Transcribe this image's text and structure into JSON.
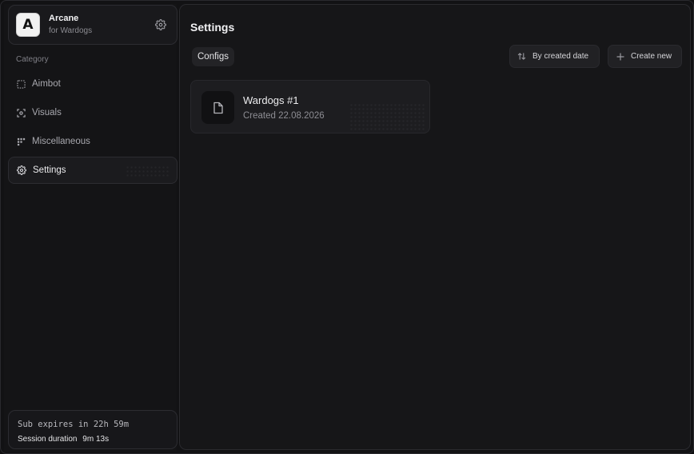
{
  "app": {
    "name": "Arcane",
    "subtitle": "for Wardogs",
    "logo_letter": "A"
  },
  "sidebar": {
    "category_label": "Category",
    "items": [
      {
        "label": "Aimbot",
        "icon": "aimbot-icon",
        "active": false
      },
      {
        "label": "Visuals",
        "icon": "visuals-icon",
        "active": false
      },
      {
        "label": "Miscellaneous",
        "icon": "misc-icon",
        "active": false
      },
      {
        "label": "Settings",
        "icon": "gear-icon",
        "active": true
      }
    ]
  },
  "status": {
    "sub_expires": "Sub expires in 22h 59m",
    "session_label": "Session duration",
    "session_value": "9m 13s"
  },
  "main": {
    "title": "Settings",
    "tab": "Configs",
    "sort_button": "By created date",
    "create_button": "Create new",
    "configs": [
      {
        "name": "Wardogs #1",
        "created": "Created 22.08.2026"
      }
    ]
  },
  "colors": {
    "background": "#121214",
    "panel": "#161618",
    "accent_text": "#ececee",
    "muted_text": "#8d8d93"
  }
}
